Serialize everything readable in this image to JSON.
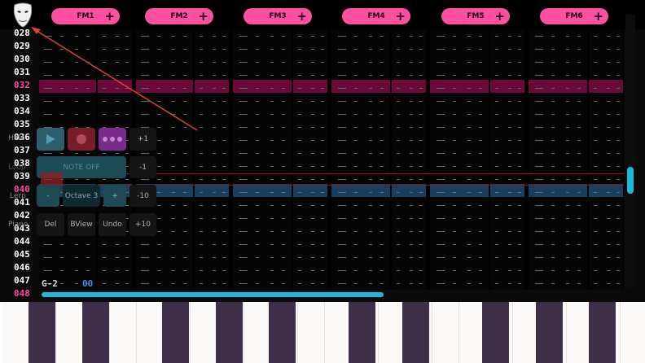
{
  "header": {
    "logo_icon": "mask-icon",
    "channels": [
      {
        "label": "FM1"
      },
      {
        "label": "FM2"
      },
      {
        "label": "FM3"
      },
      {
        "label": "FM4"
      },
      {
        "label": "FM5"
      },
      {
        "label": "FM6"
      }
    ],
    "plus_label": "+"
  },
  "rows": [
    "028",
    "029",
    "030",
    "031",
    "032",
    "033",
    "034",
    "035",
    "036",
    "037",
    "038",
    "039",
    "040",
    "041",
    "042",
    "043",
    "044",
    "045",
    "046",
    "047",
    "048"
  ],
  "highlight_rows": [
    "032",
    "040",
    "048"
  ],
  "controls": {
    "side_labels": [
      "Hide",
      "Loop",
      "Lerp",
      "Piano"
    ],
    "note_off": "NOTE OFF",
    "minus": "-",
    "octave": "Octave 3",
    "plus": "+",
    "del": "Del",
    "bview": "BView",
    "undo": "Undo",
    "step_plus1": "+1",
    "step_minus1": "-1",
    "step_minus10": "-10",
    "step_plus10": "+10",
    "play_icon": "play-icon",
    "record_icon": "record-icon",
    "more_icon": "more-dots-icon"
  },
  "status": {
    "note": "G-2",
    "instrument": "00"
  },
  "colors": {
    "accent_pink": "#ff4fa0",
    "accent_cyan": "#1fb8d8",
    "row_highlight": "#6a0a3a",
    "cursor_row": "#1a3f5e"
  }
}
